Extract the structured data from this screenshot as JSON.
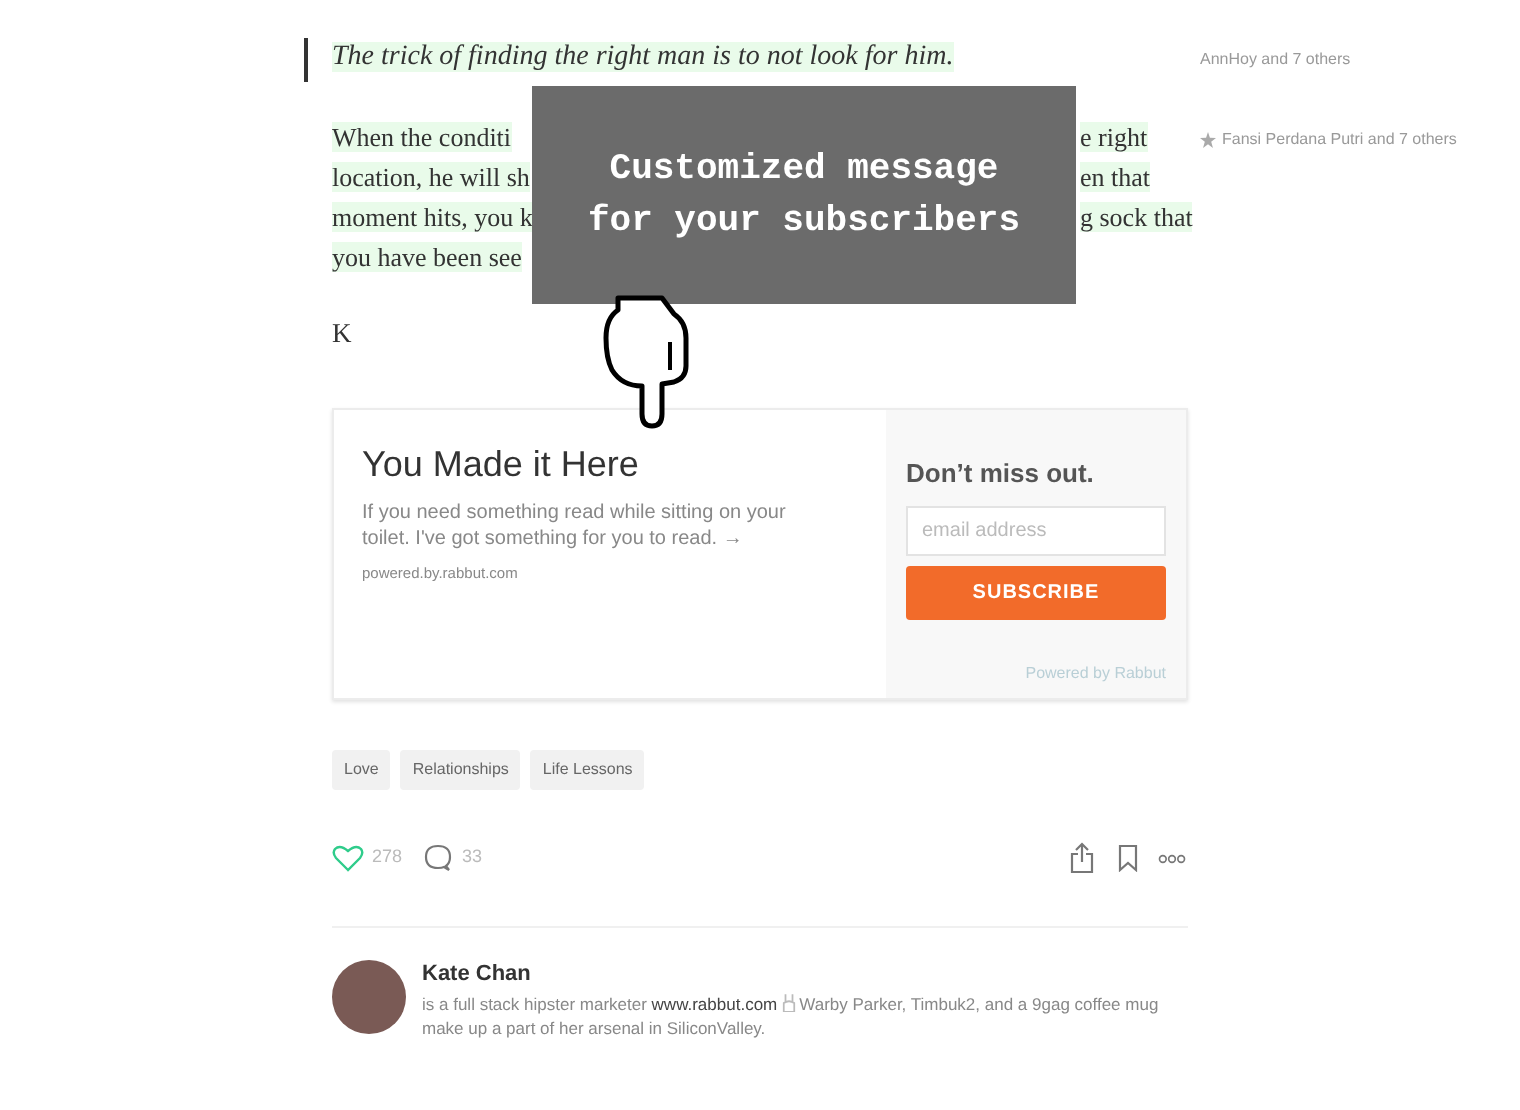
{
  "quote": {
    "text": "The trick of finding the right man is to not look for him.",
    "note": "AnnHoy and 7 others"
  },
  "paragraph": {
    "note": "Fansi Perdana Putri and 7 others",
    "lines": [
      {
        "before": "When the conditi",
        "after": "e right"
      },
      {
        "before": "location, he will sh",
        "after": "en that"
      },
      {
        "before": "moment hits, you k",
        "after": "g sock that"
      },
      {
        "before": "you have been see"
      }
    ]
  },
  "overlay": {
    "message": "Customized message for your subscribers"
  },
  "drop_cap": "K",
  "signup": {
    "title": "You Made it Here",
    "body": "If you need something read while sitting on your toilet. I've got something for you to read. →",
    "site": "powered.by.rabbut.com",
    "heading": "Don’t miss out.",
    "email": {
      "placeholder": "email address"
    },
    "button": "SUBSCRIBE",
    "credit": "Powered by Rabbut"
  },
  "tags": [
    "Love",
    "Relationships",
    "Life Lessons"
  ],
  "actions": {
    "likes": "278",
    "comments": "33",
    "liked": true
  },
  "author": {
    "name": "Kate Chan",
    "bio": {
      "before": "is a full stack hipster marketer ",
      "link": "www.rabbut.com",
      "after": "Warby Parker, Timbuk2, and a 9gag coffee mug make up a part of her arsenal in SiliconValley."
    }
  }
}
